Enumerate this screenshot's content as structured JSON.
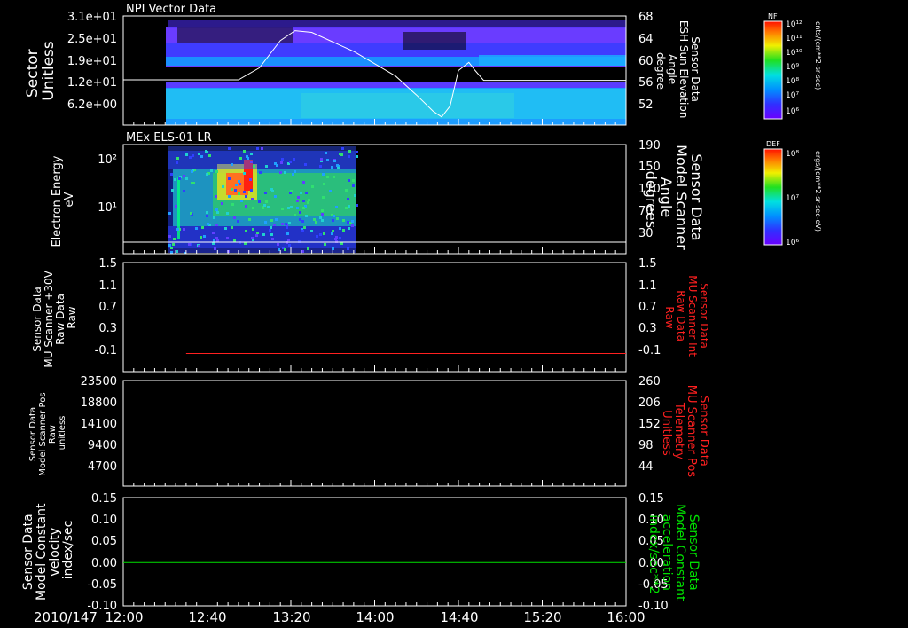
{
  "date_label": "2010/147",
  "time_ticks": [
    "12:00",
    "12:40",
    "13:20",
    "14:00",
    "14:40",
    "15:20",
    "16:00"
  ],
  "panels": {
    "npi": {
      "title": "NPI Vector Data",
      "left_label": [
        "Sector",
        "Unitless"
      ],
      "left_ticks": [
        "3.1e+01",
        "2.5e+01",
        "1.9e+01",
        "1.2e+01",
        "6.2e+00"
      ],
      "right_label": [
        "Sensor Data",
        "ESH Sun Elevation",
        "Angle",
        "degree"
      ],
      "right_ticks": [
        "68",
        "64",
        "60",
        "56",
        "52"
      ],
      "colorbar_title": "NF",
      "colorbar_ticks": [
        "10¹²",
        "10¹¹",
        "10¹⁰",
        "10⁹",
        "10⁸",
        "10⁷",
        "10⁶"
      ],
      "colorbar_units": "cnts/(cm**2-sr-sec)"
    },
    "els": {
      "title": "MEx ELS-01 LR",
      "left_label": [
        "Electron Energy",
        "eV"
      ],
      "left_ticks": [
        "10²",
        "10¹"
      ],
      "right_label": [
        "Sensor Data",
        "Model Scanner",
        "Angle",
        "degrees"
      ],
      "right_ticks": [
        "190",
        "150",
        "110",
        "70",
        "30"
      ],
      "colorbar_title": "DEF",
      "colorbar_ticks": [
        "10⁸",
        "10⁷",
        "10⁶"
      ],
      "colorbar_units": "ergs/(cm**2-sr-sec-eV)"
    },
    "p3": {
      "left_label": [
        "Sensor Data",
        "MU Scanner +30V",
        "Raw Data",
        "Raw"
      ],
      "left_ticks": [
        "1.5",
        "1.1",
        "0.7",
        "0.3",
        "-0.1"
      ],
      "right_label": [
        "Sensor Data",
        "MU Scanner Int",
        "Raw Data",
        "Raw"
      ],
      "right_ticks": [
        "1.5",
        "1.1",
        "0.7",
        "0.3",
        "-0.1"
      ]
    },
    "p4": {
      "left_label": [
        "Sensor Data",
        "Model Scanner Pos",
        "Raw",
        "unitless"
      ],
      "left_ticks": [
        "23500",
        "18800",
        "14100",
        "9400",
        "4700"
      ],
      "right_label": [
        "Sensor Data",
        "MU Scanner Pos",
        "Telemetry",
        "Unitless"
      ],
      "right_ticks": [
        "260",
        "206",
        "152",
        "98",
        "44"
      ]
    },
    "p5": {
      "left_label": [
        "Sensor Data",
        "Model Constant",
        "velocity",
        "index/sec"
      ],
      "left_ticks": [
        "0.15",
        "0.10",
        "0.05",
        "0.00",
        "-0.05",
        "-0.10"
      ],
      "right_label": [
        "Sensor Data",
        "Model Constant",
        "acceleration",
        "index/sec**2"
      ],
      "right_ticks": [
        "0.15",
        "0.10",
        "0.05",
        "0.00",
        "-0.05",
        "-0.10"
      ]
    }
  },
  "colors": {
    "background": "#000000",
    "frame": "#ffffff",
    "red_trace": "#ff2020",
    "green_trace": "#00e000",
    "spectrogram_low": "#4020ff",
    "spectrogram_high": "#ff2000"
  },
  "chart_data": [
    {
      "type": "heatmap",
      "title": "NPI Vector Data",
      "ylabel": "Sector Unitless",
      "y2label": "Sensor Data ESH Sun Elevation Angle degree",
      "x_range": [
        "12:00",
        "16:00"
      ],
      "data_start": "12:30",
      "ylim": [
        0,
        31
      ],
      "overlay_line": {
        "name": "Sensor Data ESH Sun Elevation Angle",
        "units": "degree",
        "ylim": [
          48,
          68
        ],
        "x": [
          "12:00",
          "12:30",
          "12:55",
          "13:05",
          "13:15",
          "13:22",
          "13:30",
          "13:50",
          "14:10",
          "14:20",
          "14:28",
          "14:32",
          "14:36",
          "14:40",
          "14:45",
          "14:48",
          "14:52",
          "16:00"
        ],
        "y": [
          56.3,
          56.3,
          56.3,
          58.5,
          63.5,
          65.3,
          65.0,
          61.5,
          57.0,
          53.5,
          50.5,
          49.5,
          51.5,
          58.0,
          59.5,
          58.0,
          56.2,
          56.2
        ]
      }
    },
    {
      "type": "heatmap",
      "title": "MEx ELS-01 LR",
      "ylabel": "Electron Energy eV",
      "y2label": "Sensor Data Model Scanner Angle degrees",
      "x_range": [
        "12:00",
        "16:00"
      ],
      "data_range": [
        "12:30",
        "13:36"
      ],
      "energy_range": [
        1,
        200
      ],
      "peak_region": {
        "x": [
          "12:50",
          "12:58"
        ],
        "energy": [
          20,
          150
        ]
      },
      "overlay_line": {
        "name": "Sensor Data Model Scanner Angle",
        "units": "degrees",
        "value": 12
      }
    },
    {
      "type": "line",
      "ylabel": "Sensor Data MU Scanner +30V Raw Data Raw",
      "ylim": [
        -0.3,
        1.5
      ],
      "series": [
        {
          "name": "Sensor Data MU Scanner Int Raw Data Raw",
          "x": [
            "12:30",
            "16:00"
          ],
          "y": [
            0.0,
            0.0
          ]
        }
      ]
    },
    {
      "type": "line",
      "ylabel": "Sensor Data Model Scanner Pos Raw unitless",
      "ylim": [
        0,
        23500
      ],
      "y2lim": [
        0,
        260
      ],
      "series": [
        {
          "name": "Sensor Data MU Scanner Pos Telemetry Unitless",
          "x": [
            "12:30",
            "16:00"
          ],
          "y": [
            7800,
            7800
          ]
        }
      ]
    },
    {
      "type": "line",
      "ylabel": "Sensor Data Model Constant velocity index/sec",
      "ylim": [
        -0.1,
        0.15
      ],
      "series": [
        {
          "name": "Sensor Data Model Constant acceleration index/sec**2",
          "x": [
            "12:00",
            "16:00"
          ],
          "y": [
            0.0,
            0.0
          ]
        }
      ]
    }
  ]
}
